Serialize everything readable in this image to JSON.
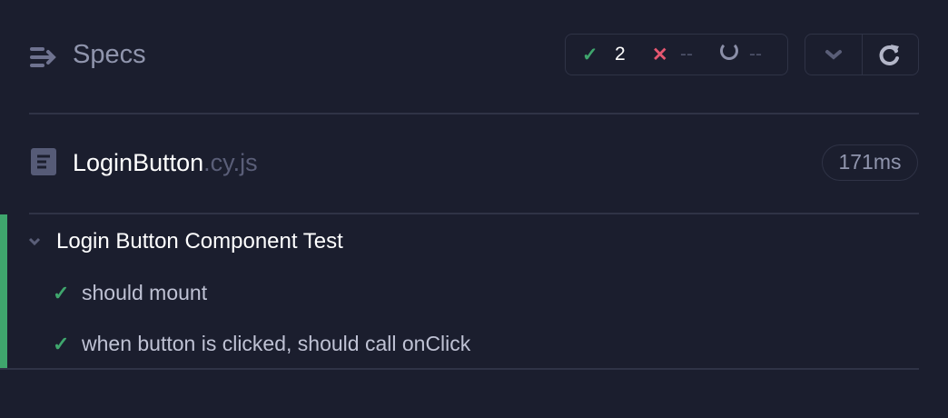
{
  "header": {
    "title": "Specs",
    "passed": "2",
    "failed": "--",
    "pending": "--"
  },
  "spec": {
    "name": "LoginButton",
    "ext": ".cy.js",
    "duration": "171ms"
  },
  "suite": {
    "title": "Login Button Component Test",
    "tests": [
      {
        "title": "should mount"
      },
      {
        "title": "when button is clicked, should call onClick"
      }
    ]
  },
  "colors": {
    "pass": "#3fa66d",
    "fail": "#e45770",
    "bg": "#1b1e2e"
  }
}
